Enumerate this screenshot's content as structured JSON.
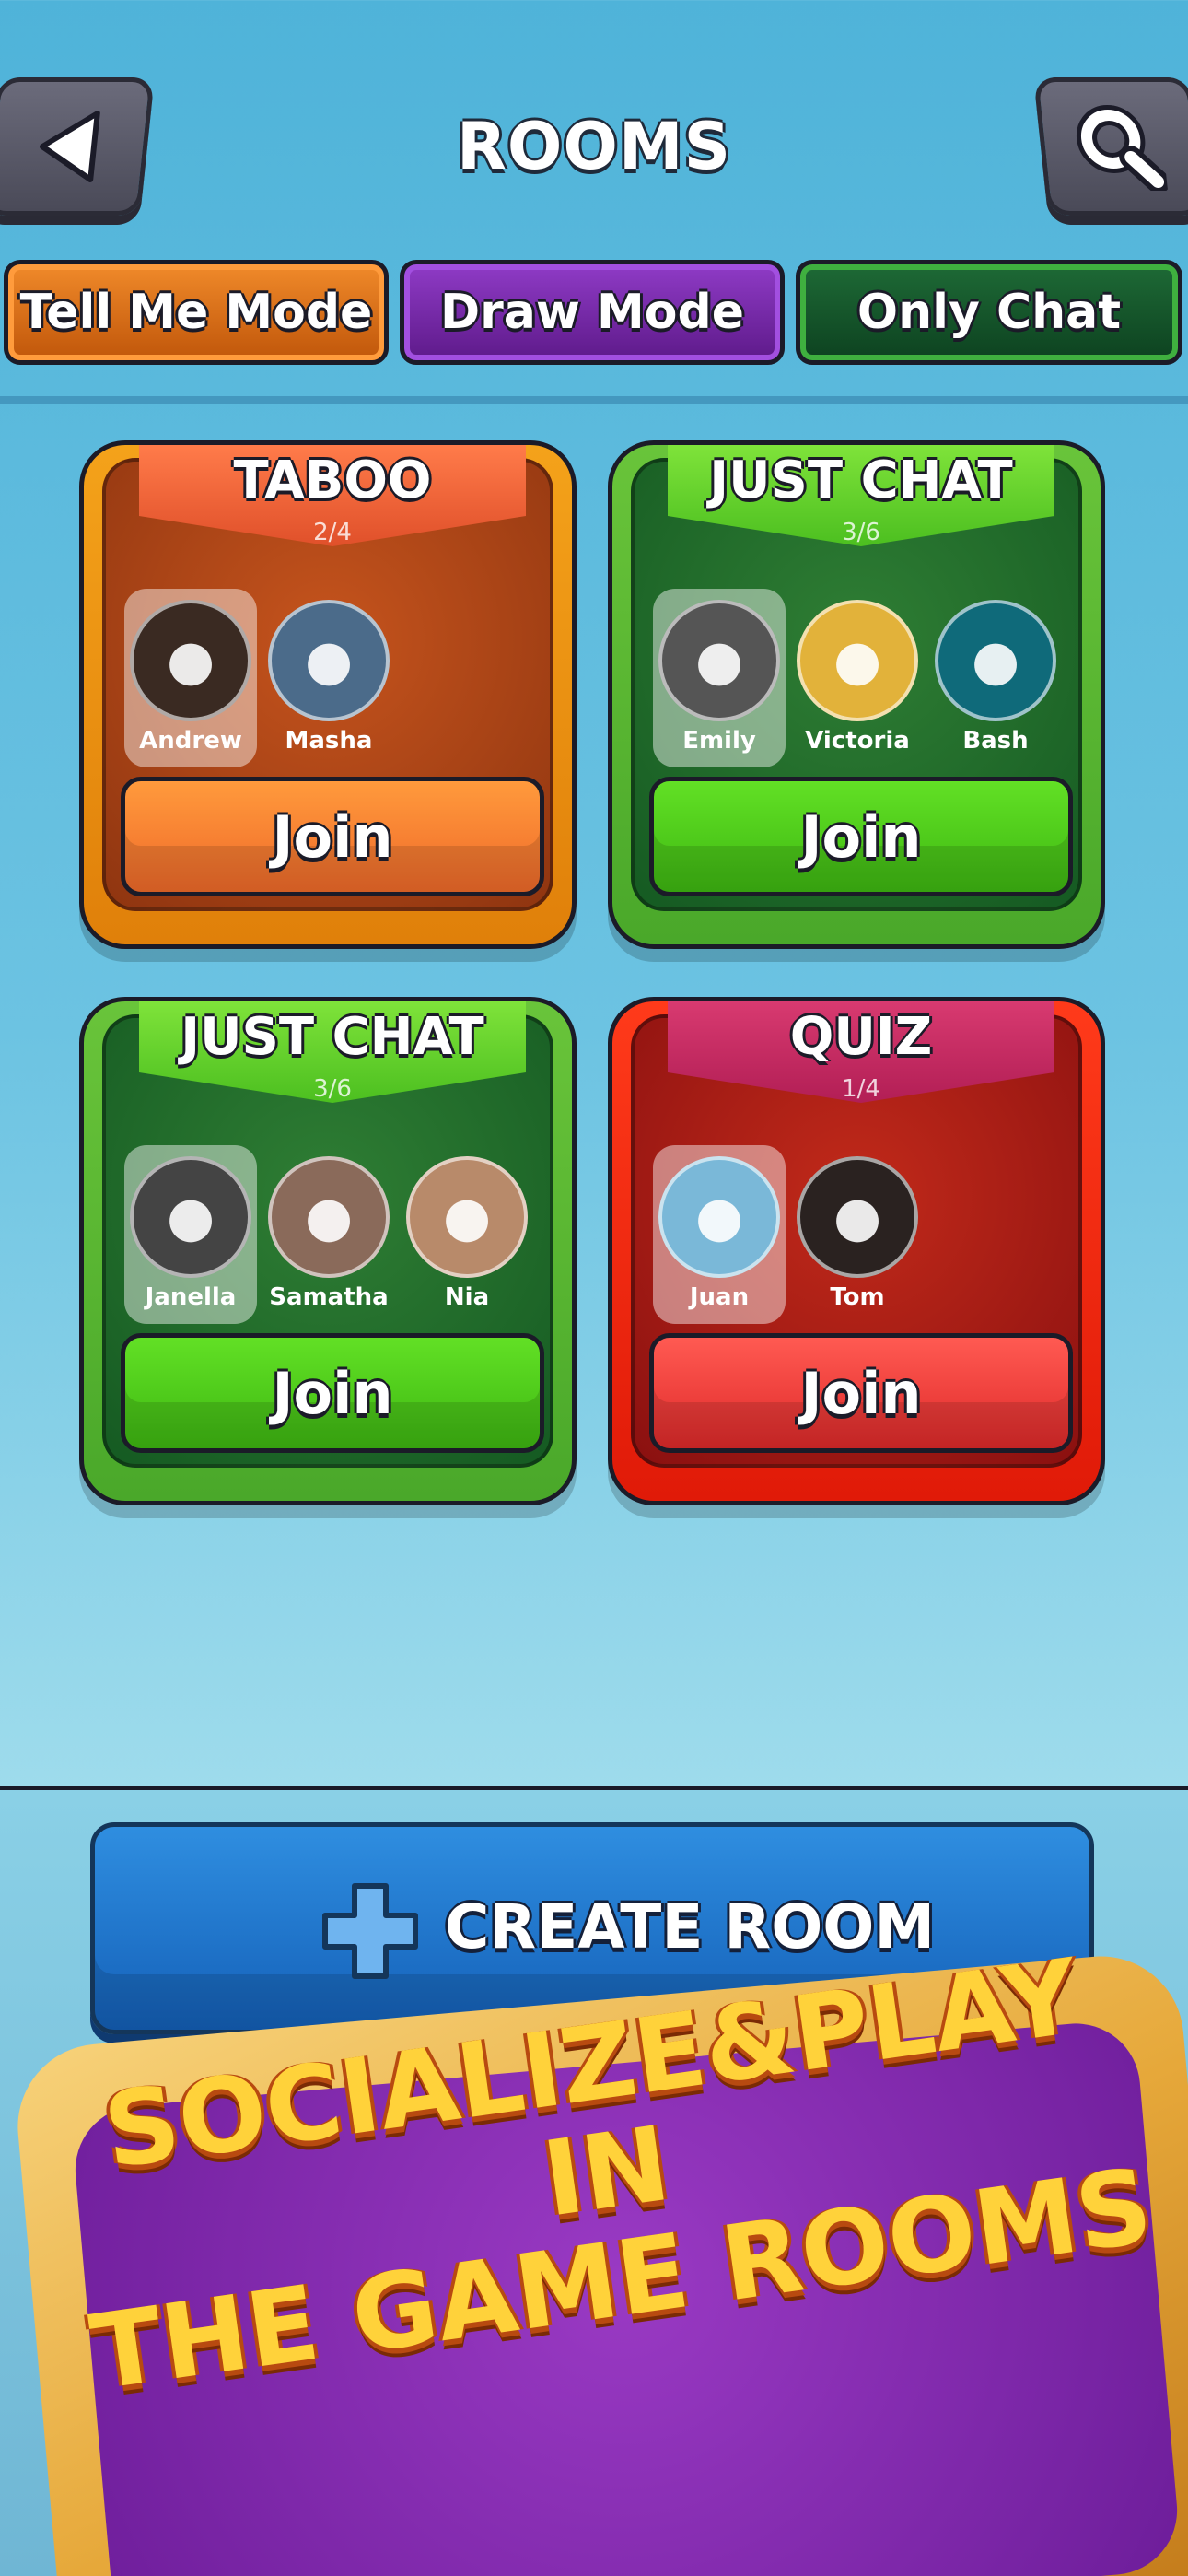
{
  "header": {
    "title": "ROOMS",
    "back_icon": "back-arrow-icon",
    "search_icon": "search-icon"
  },
  "tabs": [
    {
      "label": "Tell Me Mode",
      "color": "#e0800a"
    },
    {
      "label": "Draw Mode",
      "color": "#7a2ab0"
    },
    {
      "label": "Only Chat",
      "color": "#155a22"
    }
  ],
  "rooms": [
    {
      "title": "TABOO",
      "count": "2/4",
      "players": [
        "Andrew",
        "Masha"
      ],
      "join_label": "Join",
      "color": "#e0800a"
    },
    {
      "title": "JUST CHAT",
      "count": "3/6",
      "players": [
        "Emily",
        "Victoria",
        "Bash"
      ],
      "join_label": "Join",
      "color": "#4aa82a"
    },
    {
      "title": "JUST CHAT",
      "count": "3/6",
      "players": [
        "Janella",
        "Samatha",
        "Nia"
      ],
      "join_label": "Join",
      "color": "#4aa82a"
    },
    {
      "title": "QUIZ",
      "count": "1/4",
      "players": [
        "Juan",
        "Tom"
      ],
      "join_label": "Join",
      "color": "#e01a08"
    }
  ],
  "create_room": {
    "label": "CREATE ROOM",
    "icon": "plus-icon"
  },
  "promo": {
    "lines": [
      "SOCIALIZE&PLAY",
      "IN",
      "THE GAME ROOMS"
    ]
  }
}
